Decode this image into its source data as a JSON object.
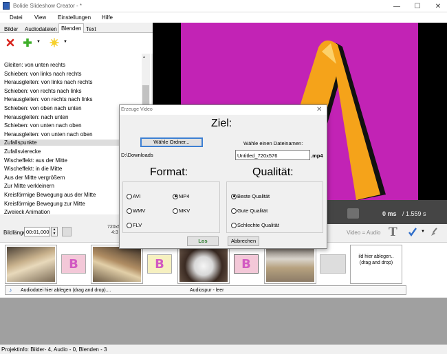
{
  "window": {
    "title": "Bolide Slideshow Creator - *"
  },
  "menu": [
    "Datei",
    "View",
    "Einstellungen",
    "Hilfe"
  ],
  "tabs": [
    "Bilder",
    "Audiodateien",
    "Blenden",
    "Text"
  ],
  "transitions": [
    "Gleiten: von unten rechts",
    "Schieben: von links nach rechts",
    "Herausgleiten: von links nach rechts",
    "Schieben: von rechts nach links",
    "Herausgleiten: von rechts nach links",
    "Schieben: von oben nach unten",
    "Herausgleiten: nach unten",
    "Schieben: von unten nach oben",
    "Herausgleiten: von unten nach oben",
    "Zufallspunkte",
    "Zufallsvierecke",
    "Wischeffekt: aus der Mitte",
    "Wischeffekt: in die Mitte",
    "Aus der Mitte vergrößern",
    "Zur Mitte verkleinern",
    "Kreisförmige Bewegung aus der Mitte",
    "Kreisförmige Bewegung zur Mitte",
    "Zweieck Animation"
  ],
  "selected_transition": "Zufallspunkte",
  "preview": {
    "time": "0 ms",
    "duration": "/ 1.559 s"
  },
  "bottom": {
    "bildlaenge_label": "Bildlänge",
    "bildlaenge_value": "00:01,000",
    "resolution_line1": "720x5",
    "resolution_line2": "4:3",
    "video_audio": "Video = Audio"
  },
  "timeline": {
    "drop_line1": "ild hier ablegen..",
    "drop_line2": "(drag and drop)",
    "audio_drop": "Audiodatei hier ablegen (drag and drop)....",
    "audio_status": "Audiospur - leer"
  },
  "status": "Projektinfo: Bilder- 4, Audio - 0, Blenden - 3",
  "dialog": {
    "title": "Erzeuge Video",
    "ziel": "Ziel:",
    "choose_folder": "Wähle Ordner...",
    "filename_label": "Wähle einen Dateinamen:",
    "folder": "D:\\Downloads",
    "filename": "Untitled_720x576",
    "extension": ".mp4",
    "format_heading": "Format:",
    "quality_heading": "Qualität:",
    "formats": [
      "AVI",
      "MP4",
      "WMV",
      "MKV",
      "FLV"
    ],
    "selected_format": "MP4",
    "qualities": [
      "Beste Qualität",
      "Gute Qualität",
      "Schlechte Qualität"
    ],
    "selected_quality": "Beste Qualität",
    "go": "Los",
    "cancel": "Abbrechen"
  },
  "colors": {
    "preview_bg": "#c223b5",
    "letter": "#f5a31a",
    "accent": "#3c7fd3"
  }
}
